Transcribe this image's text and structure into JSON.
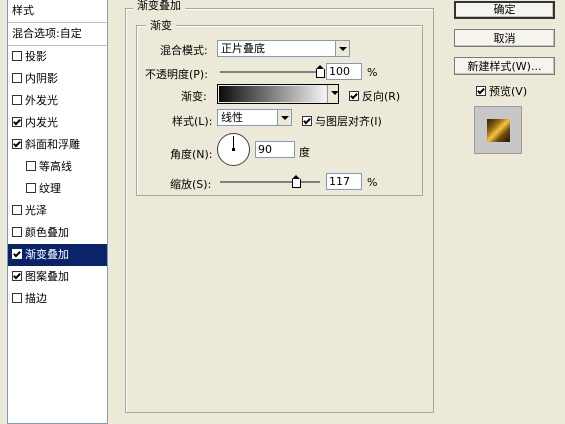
{
  "left": {
    "header": "样式",
    "items": [
      {
        "label": "混合选项:自定",
        "checkbox": false,
        "checked": false,
        "sub": false,
        "selected": false
      },
      {
        "label": "投影",
        "checkbox": true,
        "checked": false,
        "sub": false,
        "selected": false
      },
      {
        "label": "内阴影",
        "checkbox": true,
        "checked": false,
        "sub": false,
        "selected": false
      },
      {
        "label": "外发光",
        "checkbox": true,
        "checked": false,
        "sub": false,
        "selected": false
      },
      {
        "label": "内发光",
        "checkbox": true,
        "checked": true,
        "sub": false,
        "selected": false
      },
      {
        "label": "斜面和浮雕",
        "checkbox": true,
        "checked": true,
        "sub": false,
        "selected": false
      },
      {
        "label": "等高线",
        "checkbox": true,
        "checked": false,
        "sub": true,
        "selected": false
      },
      {
        "label": "纹理",
        "checkbox": true,
        "checked": false,
        "sub": true,
        "selected": false
      },
      {
        "label": "光泽",
        "checkbox": true,
        "checked": false,
        "sub": false,
        "selected": false
      },
      {
        "label": "颜色叠加",
        "checkbox": true,
        "checked": false,
        "sub": false,
        "selected": false
      },
      {
        "label": "渐变叠加",
        "checkbox": true,
        "checked": true,
        "sub": false,
        "selected": true
      },
      {
        "label": "图案叠加",
        "checkbox": true,
        "checked": true,
        "sub": false,
        "selected": false
      },
      {
        "label": "描边",
        "checkbox": true,
        "checked": false,
        "sub": false,
        "selected": false
      }
    ]
  },
  "main": {
    "title": "渐变叠加",
    "group_title": "渐变",
    "blend_label": "混合模式:",
    "blend_value": "正片叠底",
    "opacity_label": "不透明度(P):",
    "opacity_value": "100",
    "opacity_level": 100,
    "percent": "%",
    "gradient_label": "渐变:",
    "reverse_label": "反向(R)",
    "reverse_checked": true,
    "style_label": "样式(L):",
    "style_value": "线性",
    "align_label": "与图层对齐(I)",
    "align_checked": true,
    "angle_label": "角度(N):",
    "angle_value": "90",
    "angle_unit": "度",
    "scale_label": "缩放(S):",
    "scale_value": "117",
    "scale_level": 117
  },
  "right": {
    "ok": "确定",
    "cancel": "取消",
    "new_style": "新建样式(W)...",
    "preview_label": "预览(V)",
    "preview_checked": true
  },
  "colors": {
    "selection": "#0a246a",
    "dialog_bg": "#ece9d8",
    "gradient_start": "#0b0b0d",
    "gradient_end": "#f5f5f5"
  }
}
